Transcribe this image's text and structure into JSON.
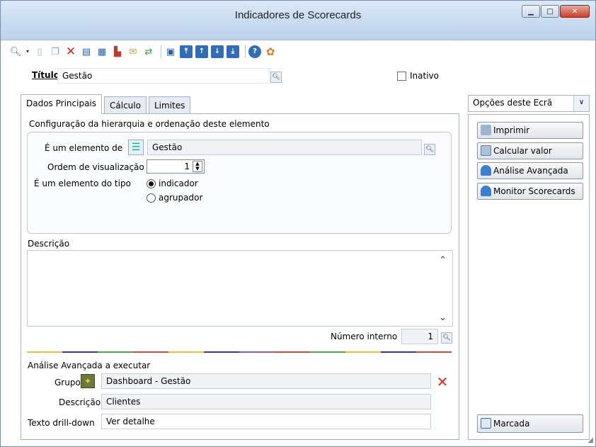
{
  "window": {
    "title": "Indicadores de Scorecards"
  },
  "toolbar": {
    "icons": [
      "search-icon",
      "new-document-icon",
      "copy-document-icon",
      "delete-icon",
      "properties-icon",
      "table-icon",
      "hierarchy-icon",
      "mail-icon",
      "refresh-icon",
      "preview-icon",
      "move-first-icon",
      "move-up-icon",
      "move-down-icon",
      "move-last-icon",
      "help-icon",
      "exit-icon"
    ]
  },
  "header": {
    "title_label": "Título",
    "title_value": "Gestão",
    "inactive_label": "Inativo",
    "inactive_checked": false
  },
  "tabs": [
    {
      "label": "Dados Principais",
      "active": true
    },
    {
      "label": "Cálculo",
      "active": false
    },
    {
      "label": "Limites",
      "active": false
    }
  ],
  "main": {
    "hierarchy_title": "Configuração da hierarquia e ordenação deste elemento",
    "element_of_label": "É um elemento de",
    "element_of_value": "Gestão",
    "order_label": "Ordem de visualização",
    "order_value": "1",
    "type_label": "É um elemento do tipo",
    "type_options": [
      {
        "label": "indicador",
        "selected": true
      },
      {
        "label": "agrupador",
        "selected": false
      }
    ],
    "description_label": "Descrição",
    "description_value": "",
    "internal_number_label": "Número interno",
    "internal_number_value": "1"
  },
  "analysis": {
    "section_title": "Análise Avançada a executar",
    "group_label": "Grupo",
    "group_value": "Dashboard - Gestão",
    "description_label": "Descrição",
    "description_value": "Clientes",
    "drilldown_label": "Texto drill-down",
    "drilldown_value": "Ver detalhe"
  },
  "side": {
    "options_label": "Opções deste Ecrã",
    "buttons": [
      {
        "label": "Imprimir"
      },
      {
        "label": "Calcular valor"
      },
      {
        "label": "Análise Avançada"
      },
      {
        "label": "Monitor Scorecards"
      }
    ],
    "marked_label": "Marcada"
  },
  "colors": {
    "divider": [
      "#e8c23a",
      "#2f3a9c",
      "#4aa84a",
      "#d04a3a",
      "#e8c23a",
      "#2f3a9c",
      "#8a5cb0",
      "#d04a3a",
      "#4aa84a",
      "#e8c23a",
      "#2f3a9c",
      "#d04a3a"
    ]
  }
}
